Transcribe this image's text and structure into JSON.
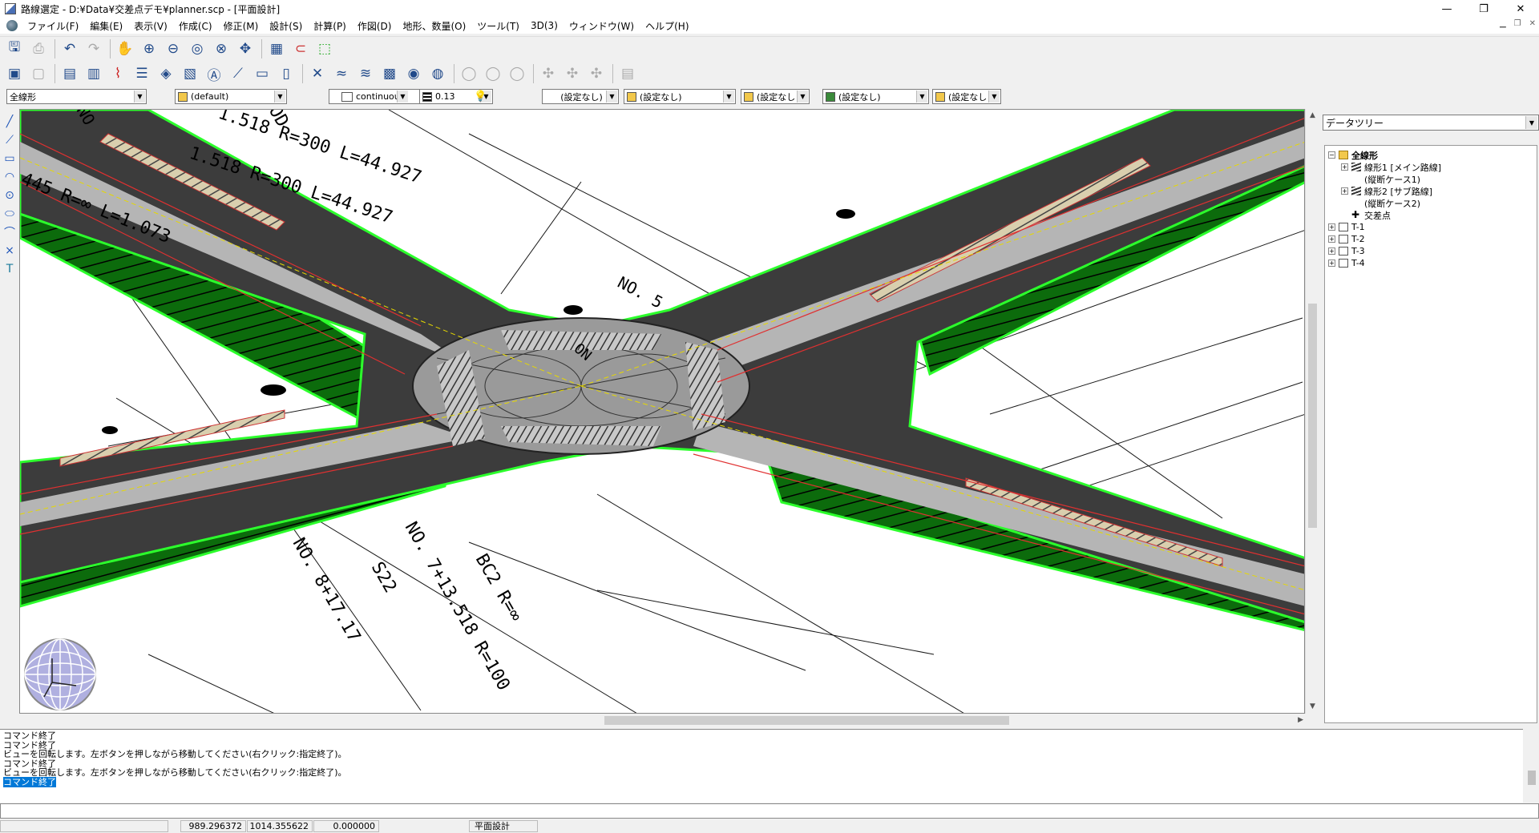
{
  "window": {
    "title": "路線選定 - D:¥Data¥交差点デモ¥planner.scp - [平面設計]",
    "controls": [
      "—",
      "❐",
      "✕"
    ]
  },
  "menu": [
    "ファイル(F)",
    "編集(E)",
    "表示(V)",
    "作成(C)",
    "修正(M)",
    "設計(S)",
    "計算(P)",
    "作図(D)",
    "地形、数量(O)",
    "ツール(T)",
    "3D(3)",
    "ウィンドウ(W)",
    "ヘルプ(H)"
  ],
  "properties": {
    "alignment": "全線形",
    "layer": "(default)",
    "linetype": "continuous",
    "lineweight": "0.13",
    "setting1": "(設定なし)",
    "setting2": "(設定なし)",
    "setting3": "(設定なし",
    "setting4": "(設定なし)",
    "setting5": "(設定なし"
  },
  "drawing_labels": {
    "l1": "1.518 R=300 L=44.927",
    "l2": "1.518 R=300 L=44.927",
    "l3": "445 R=∞ L=1.073",
    "l4": "NO. 5",
    "l5": "NO. 7+13.518 R=100",
    "l6": "NO. 8+17.17",
    "l7": "BC2 R=∞",
    "l8": "S22",
    "l9": "ON",
    "l10": "OD",
    "l11": "NO"
  },
  "right_panel": {
    "selector": "データツリー",
    "tree": [
      {
        "label": "全線形",
        "level": 0,
        "icon": "folder",
        "exp": "−"
      },
      {
        "label": "線形1 [メイン路線]",
        "level": 1,
        "icon": "layer",
        "exp": "+"
      },
      {
        "label": "(縦断ケース1)",
        "level": 2,
        "icon": "",
        "exp": ""
      },
      {
        "label": "線形2 [サブ路線]",
        "level": 1,
        "icon": "layer",
        "exp": "+"
      },
      {
        "label": "(縦断ケース2)",
        "level": 2,
        "icon": "",
        "exp": ""
      },
      {
        "label": "交差点",
        "level": 1,
        "icon": "cross",
        "exp": ""
      },
      {
        "label": "T-1",
        "level": 0,
        "icon": "doc",
        "exp": "+"
      },
      {
        "label": "T-2",
        "level": 0,
        "icon": "doc",
        "exp": "+"
      },
      {
        "label": "T-3",
        "level": 0,
        "icon": "doc",
        "exp": "+"
      },
      {
        "label": "T-4",
        "level": 0,
        "icon": "doc",
        "exp": "+"
      }
    ]
  },
  "command_log": [
    "コマンド終了",
    "コマンド終了",
    "ビューを回転します。左ボタンを押しながら移動してください(右クリック:指定終了)。",
    "コマンド終了",
    "ビューを回転します。左ボタンを押しながら移動してください(右クリック:指定終了)。",
    "コマンド終了"
  ],
  "status": {
    "x": "989.296372",
    "y": "1014.355622",
    "z": "0.000000",
    "mode": "平面設計"
  }
}
